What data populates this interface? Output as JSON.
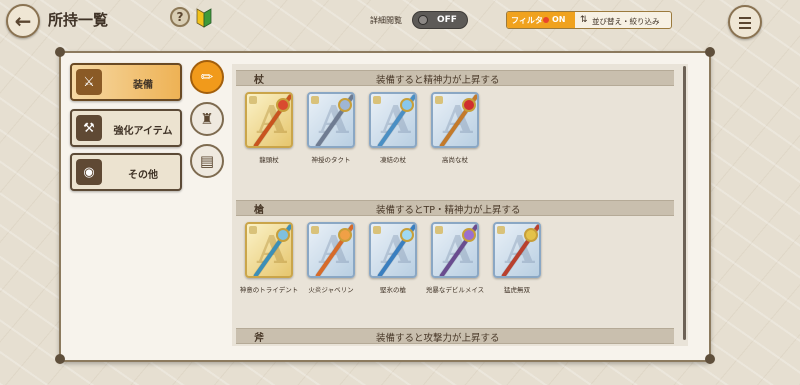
{
  "header": {
    "back_icon": "back-arrow-icon",
    "title": "所持一覧",
    "help_label": "?",
    "detail_label": "詳細閲覧",
    "detail_state": "OFF",
    "filter_label": "フィルタ",
    "filter_state": "ON",
    "sort_label": "並び替え・絞り込み",
    "menu_icon": "menu-icon"
  },
  "categories": [
    {
      "label": "装備",
      "icon": "sword-emblem-icon",
      "active": true
    },
    {
      "label": "強化アイテム",
      "icon": "hammer-icon",
      "active": false
    },
    {
      "label": "その他",
      "icon": "pouch-icon",
      "active": false
    }
  ],
  "subfilters": [
    {
      "icon": "sword-icon",
      "active": true
    },
    {
      "icon": "armor-icon",
      "active": false
    },
    {
      "icon": "book-icon",
      "active": false
    }
  ],
  "sections": [
    {
      "type": "杖",
      "desc": "装備すると精神力が上昇する",
      "items": [
        {
          "name": "龍頭杖",
          "frame": "gold",
          "color": "#c9541f",
          "gem": "#d94a2f"
        },
        {
          "name": "神授のタクト",
          "frame": "silver",
          "color": "#6f7c92",
          "gem": "#9fb6d4"
        },
        {
          "name": "凍結の杖",
          "frame": "silver",
          "color": "#4a8fc4",
          "gem": "#88c7ec"
        },
        {
          "name": "高尚な杖",
          "frame": "silver",
          "color": "#c47a2a",
          "gem": "#cf2e2e"
        }
      ]
    },
    {
      "type": "槍",
      "desc": "装備するとTP・精神力が上昇する",
      "items": [
        {
          "name": "神意のトライデント",
          "frame": "gold",
          "color": "#3c8fb8",
          "gem": "#7fc0de"
        },
        {
          "name": "火炎ジャベリン",
          "frame": "silver",
          "color": "#d76b2a",
          "gem": "#f0a046"
        },
        {
          "name": "堅氷の槍",
          "frame": "silver",
          "color": "#3a7fc0",
          "gem": "#9fd8f2"
        },
        {
          "name": "兇暴なデビルメイス",
          "frame": "silver",
          "color": "#6a4c8f",
          "gem": "#9a6fcf"
        },
        {
          "name": "猛虎無双",
          "frame": "silver",
          "color": "#b9402e",
          "gem": "#e4c24a"
        }
      ]
    },
    {
      "type": "斧",
      "desc": "装備すると攻撃力が上昇する",
      "items": []
    }
  ]
}
